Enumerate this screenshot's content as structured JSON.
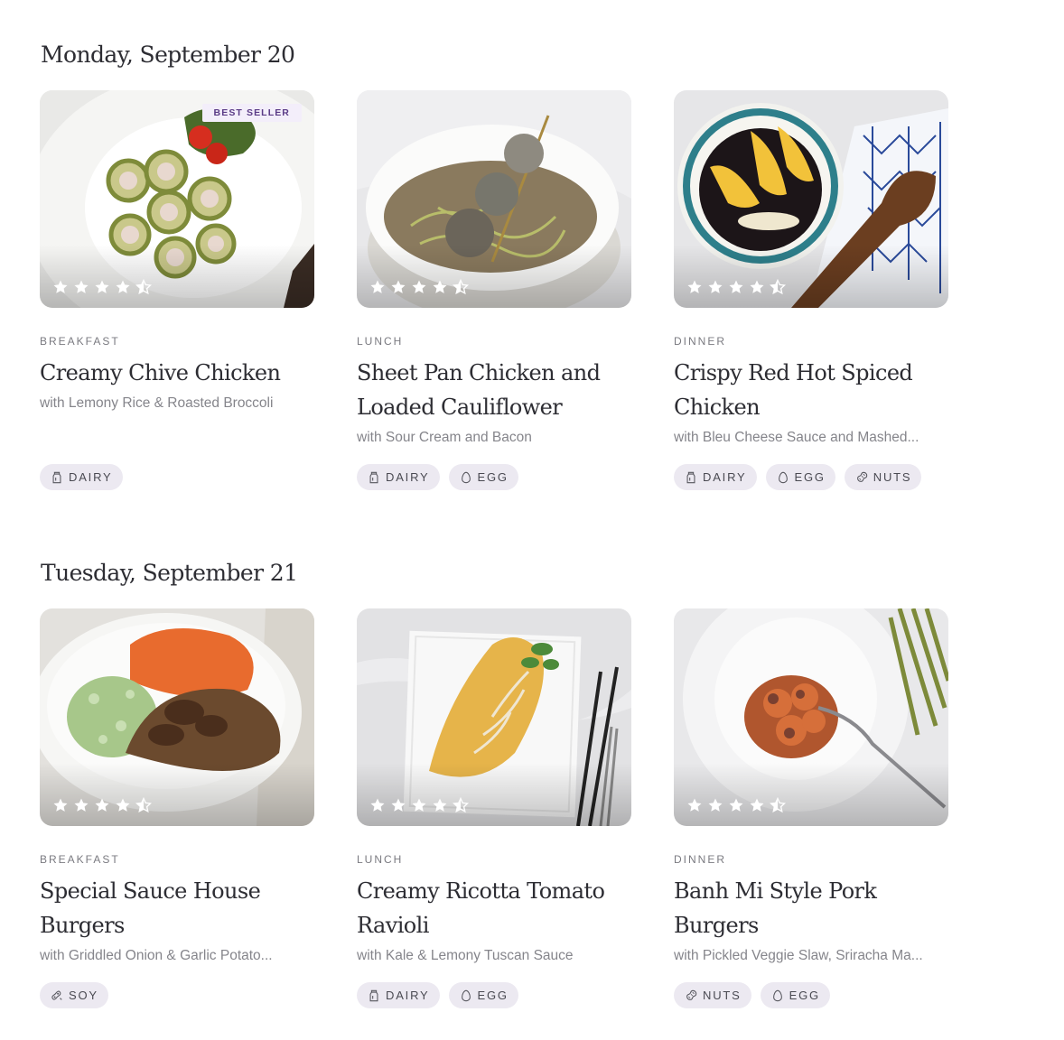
{
  "days": [
    {
      "heading": "Monday, September 20",
      "meals": [
        {
          "category": "BREAKFAST",
          "title": "Creamy Chive Chicken",
          "subtitle": "with Lemony Rice & Roasted Broccoli",
          "badge": "BEST SELLER",
          "rating": 4.5,
          "tags": [
            {
              "label": "DAIRY",
              "icon": "dairy-icon"
            }
          ]
        },
        {
          "category": "LUNCH",
          "title": "Sheet Pan Chicken and Loaded Cauliflower",
          "subtitle": "with Sour Cream and Bacon",
          "rating": 4.5,
          "tags": [
            {
              "label": "DAIRY",
              "icon": "dairy-icon"
            },
            {
              "label": "EGG",
              "icon": "egg-icon"
            }
          ]
        },
        {
          "category": "DINNER",
          "title": "Crispy Red Hot Spiced Chicken",
          "subtitle": "with Bleu Cheese Sauce and Mashed...",
          "rating": 4.5,
          "tags": [
            {
              "label": "DAIRY",
              "icon": "dairy-icon"
            },
            {
              "label": "EGG",
              "icon": "egg-icon"
            },
            {
              "label": "NUTS",
              "icon": "peanut-icon"
            }
          ]
        }
      ]
    },
    {
      "heading": "Tuesday, September 21",
      "meals": [
        {
          "category": "BREAKFAST",
          "title": "Special Sauce House Burgers",
          "subtitle": "with Griddled Onion & Garlic Potato...",
          "rating": 4.5,
          "tags": [
            {
              "label": "SOY",
              "icon": "soy-icon"
            }
          ]
        },
        {
          "category": "LUNCH",
          "title": "Creamy Ricotta Tomato Ravioli",
          "subtitle": "with Kale & Lemony Tuscan Sauce",
          "rating": 4.5,
          "tags": [
            {
              "label": "DAIRY",
              "icon": "dairy-icon"
            },
            {
              "label": "EGG",
              "icon": "egg-icon"
            }
          ]
        },
        {
          "category": "DINNER",
          "title": "Banh Mi Style Pork Burgers",
          "subtitle": "with Pickled Veggie Slaw, Sriracha Ma...",
          "rating": 4.5,
          "tags": [
            {
              "label": "NUTS",
              "icon": "peanut-icon"
            },
            {
              "label": "EGG",
              "icon": "egg-icon"
            }
          ]
        }
      ]
    }
  ]
}
